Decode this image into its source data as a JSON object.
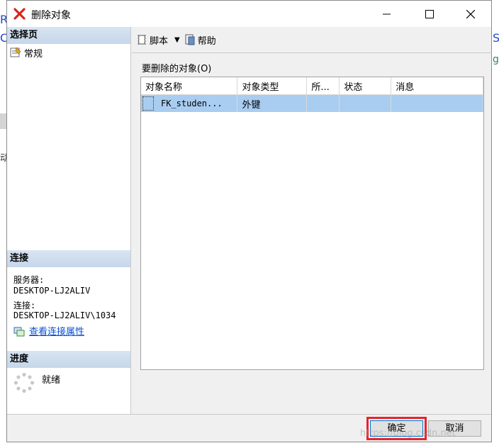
{
  "window": {
    "title": "删除对象",
    "minimize": "minimize",
    "maximize": "maximize",
    "close": "close"
  },
  "background": {
    "glyph_r": "R",
    "glyph_c": "C",
    "glyph_s": "S",
    "glyph_g": "g",
    "glyph_side": "动"
  },
  "left": {
    "select_page_header": "选择页",
    "page_general": "常规",
    "connection_header": "连接",
    "server_label": "服务器:",
    "server_value": "DESKTOP-LJ2ALIV",
    "connection_label": "连接:",
    "connection_value": "DESKTOP-LJ2ALIV\\1034",
    "view_connection_link": "查看连接属性",
    "progress_header": "进度",
    "progress_status": "就绪"
  },
  "toolbar": {
    "script_label": "脚本",
    "help_label": "帮助"
  },
  "objects": {
    "label": "要删除的对象(O)",
    "columns": [
      "对象名称",
      "对象类型",
      "所...",
      "状态",
      "消息"
    ],
    "rows": [
      [
        "FK_studen...",
        "外键",
        "",
        "",
        ""
      ]
    ]
  },
  "buttons": {
    "ok": "确定",
    "cancel": "取消"
  },
  "watermark": "https://blog.csdn.net",
  "colors": {
    "selection": "#a9cdf0",
    "link": "#0b4fd1",
    "highlight": "#e8232a",
    "header": "#c6d7ea"
  }
}
